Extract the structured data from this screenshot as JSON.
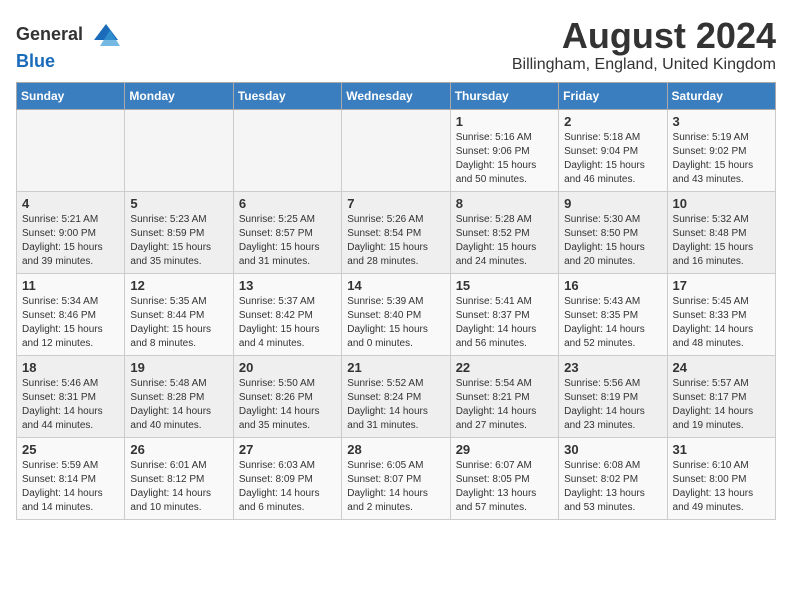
{
  "header": {
    "logo_general": "General",
    "logo_blue": "Blue",
    "month_title": "August 2024",
    "location": "Billingham, England, United Kingdom"
  },
  "days_of_week": [
    "Sunday",
    "Monday",
    "Tuesday",
    "Wednesday",
    "Thursday",
    "Friday",
    "Saturday"
  ],
  "weeks": [
    [
      {
        "day": "",
        "info": ""
      },
      {
        "day": "",
        "info": ""
      },
      {
        "day": "",
        "info": ""
      },
      {
        "day": "",
        "info": ""
      },
      {
        "day": "1",
        "info": "Sunrise: 5:16 AM\nSunset: 9:06 PM\nDaylight: 15 hours\nand 50 minutes."
      },
      {
        "day": "2",
        "info": "Sunrise: 5:18 AM\nSunset: 9:04 PM\nDaylight: 15 hours\nand 46 minutes."
      },
      {
        "day": "3",
        "info": "Sunrise: 5:19 AM\nSunset: 9:02 PM\nDaylight: 15 hours\nand 43 minutes."
      }
    ],
    [
      {
        "day": "4",
        "info": "Sunrise: 5:21 AM\nSunset: 9:00 PM\nDaylight: 15 hours\nand 39 minutes."
      },
      {
        "day": "5",
        "info": "Sunrise: 5:23 AM\nSunset: 8:59 PM\nDaylight: 15 hours\nand 35 minutes."
      },
      {
        "day": "6",
        "info": "Sunrise: 5:25 AM\nSunset: 8:57 PM\nDaylight: 15 hours\nand 31 minutes."
      },
      {
        "day": "7",
        "info": "Sunrise: 5:26 AM\nSunset: 8:54 PM\nDaylight: 15 hours\nand 28 minutes."
      },
      {
        "day": "8",
        "info": "Sunrise: 5:28 AM\nSunset: 8:52 PM\nDaylight: 15 hours\nand 24 minutes."
      },
      {
        "day": "9",
        "info": "Sunrise: 5:30 AM\nSunset: 8:50 PM\nDaylight: 15 hours\nand 20 minutes."
      },
      {
        "day": "10",
        "info": "Sunrise: 5:32 AM\nSunset: 8:48 PM\nDaylight: 15 hours\nand 16 minutes."
      }
    ],
    [
      {
        "day": "11",
        "info": "Sunrise: 5:34 AM\nSunset: 8:46 PM\nDaylight: 15 hours\nand 12 minutes."
      },
      {
        "day": "12",
        "info": "Sunrise: 5:35 AM\nSunset: 8:44 PM\nDaylight: 15 hours\nand 8 minutes."
      },
      {
        "day": "13",
        "info": "Sunrise: 5:37 AM\nSunset: 8:42 PM\nDaylight: 15 hours\nand 4 minutes."
      },
      {
        "day": "14",
        "info": "Sunrise: 5:39 AM\nSunset: 8:40 PM\nDaylight: 15 hours\nand 0 minutes."
      },
      {
        "day": "15",
        "info": "Sunrise: 5:41 AM\nSunset: 8:37 PM\nDaylight: 14 hours\nand 56 minutes."
      },
      {
        "day": "16",
        "info": "Sunrise: 5:43 AM\nSunset: 8:35 PM\nDaylight: 14 hours\nand 52 minutes."
      },
      {
        "day": "17",
        "info": "Sunrise: 5:45 AM\nSunset: 8:33 PM\nDaylight: 14 hours\nand 48 minutes."
      }
    ],
    [
      {
        "day": "18",
        "info": "Sunrise: 5:46 AM\nSunset: 8:31 PM\nDaylight: 14 hours\nand 44 minutes."
      },
      {
        "day": "19",
        "info": "Sunrise: 5:48 AM\nSunset: 8:28 PM\nDaylight: 14 hours\nand 40 minutes."
      },
      {
        "day": "20",
        "info": "Sunrise: 5:50 AM\nSunset: 8:26 PM\nDaylight: 14 hours\nand 35 minutes."
      },
      {
        "day": "21",
        "info": "Sunrise: 5:52 AM\nSunset: 8:24 PM\nDaylight: 14 hours\nand 31 minutes."
      },
      {
        "day": "22",
        "info": "Sunrise: 5:54 AM\nSunset: 8:21 PM\nDaylight: 14 hours\nand 27 minutes."
      },
      {
        "day": "23",
        "info": "Sunrise: 5:56 AM\nSunset: 8:19 PM\nDaylight: 14 hours\nand 23 minutes."
      },
      {
        "day": "24",
        "info": "Sunrise: 5:57 AM\nSunset: 8:17 PM\nDaylight: 14 hours\nand 19 minutes."
      }
    ],
    [
      {
        "day": "25",
        "info": "Sunrise: 5:59 AM\nSunset: 8:14 PM\nDaylight: 14 hours\nand 14 minutes."
      },
      {
        "day": "26",
        "info": "Sunrise: 6:01 AM\nSunset: 8:12 PM\nDaylight: 14 hours\nand 10 minutes."
      },
      {
        "day": "27",
        "info": "Sunrise: 6:03 AM\nSunset: 8:09 PM\nDaylight: 14 hours\nand 6 minutes."
      },
      {
        "day": "28",
        "info": "Sunrise: 6:05 AM\nSunset: 8:07 PM\nDaylight: 14 hours\nand 2 minutes."
      },
      {
        "day": "29",
        "info": "Sunrise: 6:07 AM\nSunset: 8:05 PM\nDaylight: 13 hours\nand 57 minutes."
      },
      {
        "day": "30",
        "info": "Sunrise: 6:08 AM\nSunset: 8:02 PM\nDaylight: 13 hours\nand 53 minutes."
      },
      {
        "day": "31",
        "info": "Sunrise: 6:10 AM\nSunset: 8:00 PM\nDaylight: 13 hours\nand 49 minutes."
      }
    ]
  ]
}
